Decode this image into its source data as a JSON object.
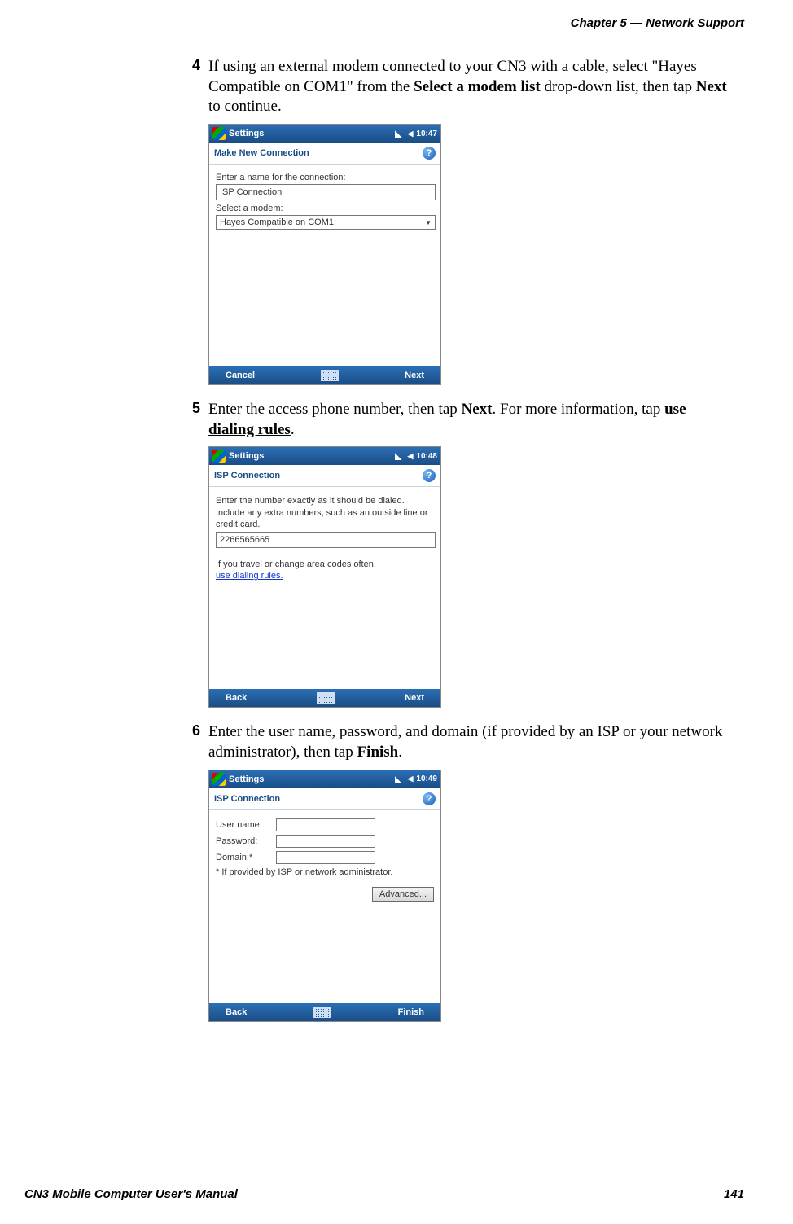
{
  "header": {
    "chapter": "Chapter 5 —  Network Support"
  },
  "steps": {
    "s4": {
      "num": "4",
      "text_a": "If using an external modem connected to your CN3 with a cable, select \"Hayes Compatible on COM1\" from the ",
      "bold_a": "Select a modem list",
      "text_b": " drop-down list, then tap ",
      "bold_b": "Next",
      "text_c": " to continue."
    },
    "s5": {
      "num": "5",
      "text_a": "Enter the access phone number, then tap ",
      "bold_a": "Next",
      "text_b": ". For more information, tap ",
      "under_a": "use dialing rules",
      "text_c": "."
    },
    "s6": {
      "num": "6",
      "text_a": "Enter the user name, password, and domain (if provided by an ISP or your network administrator), then tap ",
      "bold_a": "Finish",
      "text_b": "."
    }
  },
  "phone1": {
    "topTitle": "Settings",
    "time": "10:47",
    "subTitle": "Make New Connection",
    "label1": "Enter a name for the connection:",
    "input1": "ISP Connection",
    "label2": "Select a modem:",
    "select1": "Hayes Compatible on COM1:",
    "btnLeft": "Cancel",
    "btnRight": "Next"
  },
  "phone2": {
    "topTitle": "Settings",
    "time": "10:48",
    "subTitle": "ISP Connection",
    "para1": "Enter the number exactly as it should be dialed.  Include any extra numbers, such as an outside line or credit card.",
    "input1": "2266565665",
    "para2": "If you travel or change area codes often,",
    "link1": "use dialing rules.",
    "btnLeft": "Back",
    "btnRight": "Next"
  },
  "phone3": {
    "topTitle": "Settings",
    "time": "10:49",
    "subTitle": "ISP Connection",
    "lblUser": "User name:",
    "lblPass": "Password:",
    "lblDomain": "Domain:*",
    "note": "* If provided by ISP or network administrator.",
    "advanced": "Advanced...",
    "btnLeft": "Back",
    "btnRight": "Finish"
  },
  "footer": {
    "title": "CN3 Mobile Computer User's Manual",
    "page": "141"
  }
}
